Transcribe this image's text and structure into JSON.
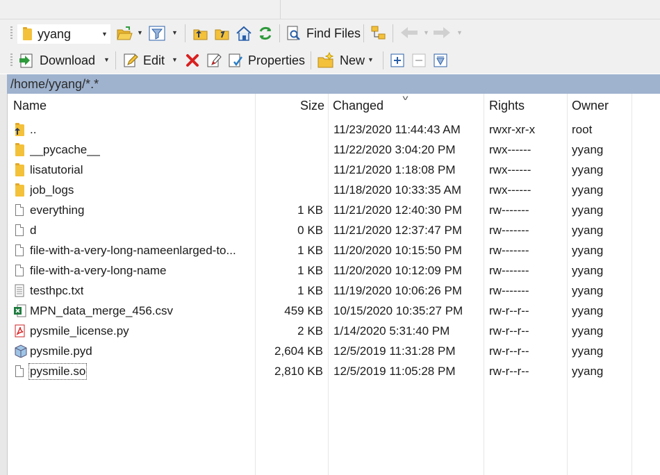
{
  "toolbar1": {
    "location_value": "yyang",
    "find_files_label": "Find Files"
  },
  "toolbar2": {
    "download_label": "Download",
    "edit_label": "Edit",
    "properties_label": "Properties",
    "new_label": "New"
  },
  "path": "/home/yyang/*.*",
  "columns": {
    "name": "Name",
    "size": "Size",
    "changed": "Changed",
    "rights": "Rights",
    "owner": "Owner"
  },
  "files": [
    {
      "name": "..",
      "size": "",
      "changed": "11/23/2020 11:44:43 AM",
      "rights": "rwxr-xr-x",
      "owner": "root",
      "icon": "parent-folder-icon"
    },
    {
      "name": "__pycache__",
      "size": "",
      "changed": "11/22/2020 3:04:20 PM",
      "rights": "rwx------",
      "owner": "yyang",
      "icon": "folder-icon"
    },
    {
      "name": "lisatutorial",
      "size": "",
      "changed": "11/21/2020 1:18:08 PM",
      "rights": "rwx------",
      "owner": "yyang",
      "icon": "folder-icon"
    },
    {
      "name": "job_logs",
      "size": "",
      "changed": "11/18/2020 10:33:35 AM",
      "rights": "rwx------",
      "owner": "yyang",
      "icon": "folder-icon"
    },
    {
      "name": "everything",
      "size": "1 KB",
      "changed": "11/21/2020 12:40:30 PM",
      "rights": "rw-------",
      "owner": "yyang",
      "icon": "file-icon"
    },
    {
      "name": "d",
      "size": "0 KB",
      "changed": "11/21/2020 12:37:47 PM",
      "rights": "rw-------",
      "owner": "yyang",
      "icon": "file-icon"
    },
    {
      "name": "file-with-a-very-long-nameenlarged-to...",
      "size": "1 KB",
      "changed": "11/20/2020 10:15:50 PM",
      "rights": "rw-------",
      "owner": "yyang",
      "icon": "file-icon"
    },
    {
      "name": "file-with-a-very-long-name",
      "size": "1 KB",
      "changed": "11/20/2020 10:12:09 PM",
      "rights": "rw-------",
      "owner": "yyang",
      "icon": "file-icon"
    },
    {
      "name": "testhpc.txt",
      "size": "1 KB",
      "changed": "11/19/2020 10:06:26 PM",
      "rights": "rw-------",
      "owner": "yyang",
      "icon": "text-file-icon"
    },
    {
      "name": "MPN_data_merge_456.csv",
      "size": "459 KB",
      "changed": "10/15/2020 10:35:27 PM",
      "rights": "rw-r--r--",
      "owner": "yyang",
      "icon": "excel-file-icon"
    },
    {
      "name": "pysmile_license.py",
      "size": "2 KB",
      "changed": "1/14/2020 5:31:40 PM",
      "rights": "rw-r--r--",
      "owner": "yyang",
      "icon": "pdf-file-icon"
    },
    {
      "name": "pysmile.pyd",
      "size": "2,604 KB",
      "changed": "12/5/2019 11:31:28 PM",
      "rights": "rw-r--r--",
      "owner": "yyang",
      "icon": "pyd-file-icon"
    },
    {
      "name": "pysmile.so",
      "size": "2,810 KB",
      "changed": "12/5/2019 11:05:28 PM",
      "rights": "rw-r--r--",
      "owner": "yyang",
      "icon": "file-icon"
    }
  ],
  "colors": {
    "path_bar": "#9fb3cf",
    "toolbar_bg": "#f0f0f0",
    "folder": "#f3c13a"
  }
}
